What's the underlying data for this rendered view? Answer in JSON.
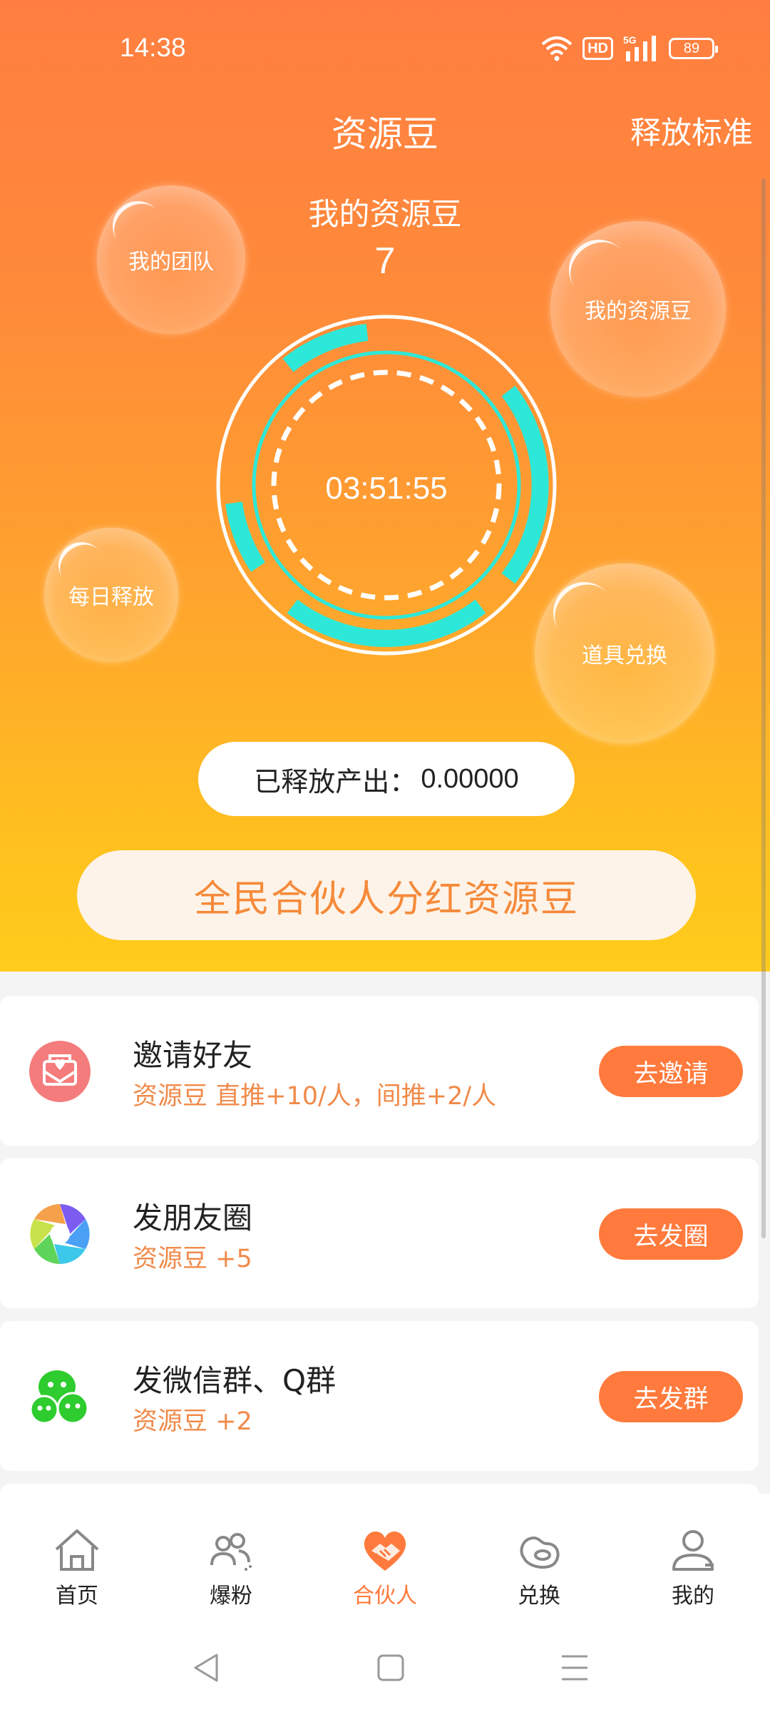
{
  "status": {
    "time": "14:38",
    "hd": "HD",
    "signal": "5G",
    "battery": "89"
  },
  "header": {
    "title": "资源豆",
    "right_link": "释放标准"
  },
  "beans": {
    "label": "我的资源豆",
    "value": "7"
  },
  "bubbles": [
    {
      "label": "我的团队"
    },
    {
      "label": "我的资源豆"
    },
    {
      "label": "每日释放"
    },
    {
      "label": "道具兑换"
    }
  ],
  "timer": "03:51:55",
  "released": {
    "label": "已释放产出：",
    "value": "0.00000"
  },
  "cta_label": "全民合伙人分红资源豆",
  "tasks": [
    {
      "title": "邀请好友",
      "subtitle": "资源豆 直推+10/人，间推+2/人",
      "button": "去邀请",
      "icon": "invite-envelope-icon"
    },
    {
      "title": "发朋友圈",
      "subtitle": "资源豆 +5",
      "button": "去发圈",
      "icon": "moments-aperture-icon"
    },
    {
      "title": "发微信群、Q群",
      "subtitle": "资源豆 +2",
      "button": "去发群",
      "icon": "wechat-icon"
    }
  ],
  "tabs": [
    {
      "label": "首页",
      "icon": "home-icon"
    },
    {
      "label": "爆粉",
      "icon": "fans-icon"
    },
    {
      "label": "合伙人",
      "icon": "partner-heart-icon",
      "active": true
    },
    {
      "label": "兑换",
      "icon": "exchange-bean-icon"
    },
    {
      "label": "我的",
      "icon": "profile-icon"
    }
  ],
  "colors": {
    "brand_orange": "#ff7a3c",
    "gradient_top": "#ff7e40",
    "gradient_bottom": "#ffcc1c",
    "ring_cyan": "#2de8d8",
    "subtitle_orange": "#f08a4a"
  }
}
